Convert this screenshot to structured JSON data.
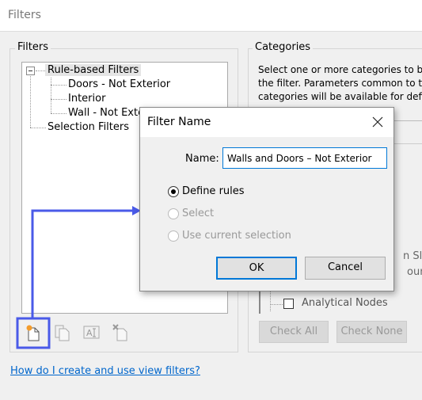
{
  "window": {
    "title": "Filters"
  },
  "filters_group": {
    "label": "Filters",
    "tree": {
      "root": "Rule-based Filters",
      "children": [
        "Doors - Not Exterior",
        "Interior",
        "Wall - Not Exterior"
      ],
      "selection": "Selection Filters"
    },
    "toolbar": [
      {
        "icon": "new-filter-icon"
      },
      {
        "icon": "duplicate-icon"
      },
      {
        "icon": "rename-icon"
      },
      {
        "icon": "delete-icon"
      }
    ]
  },
  "categories_group": {
    "label": "Categories",
    "description": "Select one or more categories to be included in the filter.  Parameters common to these categories will be available for defining filter rules.",
    "desc_lines": [
      "Select one or more categories to be",
      "the filter.  Parameters common to th",
      "categories will be available for defin"
    ],
    "list_fragments": [
      "n Slab",
      "ounda"
    ],
    "list_items": [
      {
        "label": "Analytical Nodes",
        "checked": false
      }
    ],
    "check_all": "Check All",
    "check_none": "Check None"
  },
  "help_link": "How do I create and use view filters?",
  "dialog": {
    "title": "Filter Name",
    "name_label": "Name:",
    "name_value": "Walls and Doors – Not Exterior",
    "options": [
      {
        "label": "Define rules",
        "selected": true,
        "enabled": true
      },
      {
        "label": "Select",
        "selected": false,
        "enabled": false
      },
      {
        "label": "Use current selection",
        "selected": false,
        "enabled": false
      }
    ],
    "ok": "OK",
    "cancel": "Cancel"
  },
  "annotation": {
    "color": "#4a5ae8"
  }
}
